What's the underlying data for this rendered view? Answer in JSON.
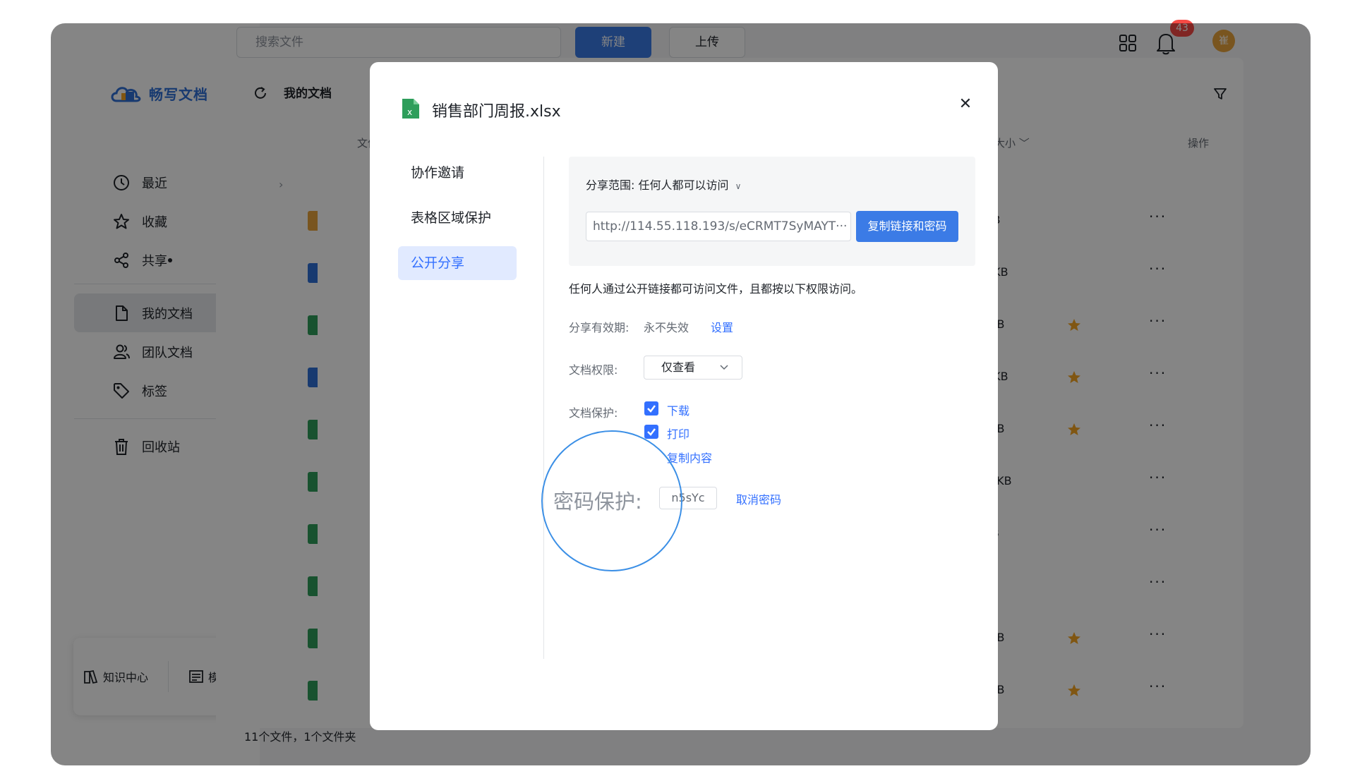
{
  "app": {
    "logo_text": "畅写文档"
  },
  "sidebar": {
    "items": [
      {
        "label": "最近"
      },
      {
        "label": "收藏"
      },
      {
        "label": "共享"
      },
      {
        "label": "我的文档"
      },
      {
        "label": "团队文档"
      },
      {
        "label": "标签"
      },
      {
        "label": "回收站"
      }
    ],
    "bottom": {
      "knowledge": "知识中心",
      "templates": "模板库"
    }
  },
  "topbar": {
    "search_placeholder": "搜索文件",
    "new_label": "新建",
    "upload_label": "上传",
    "notifications": "43",
    "avatar_text": "崔"
  },
  "content": {
    "breadcrumb": "我的文档",
    "columns": {
      "name": "文件名",
      "size": "大小",
      "actions": "操作"
    },
    "rows": [
      {
        "size": "8MB",
        "starred": false
      },
      {
        "size": "93.4KB",
        "starred": false
      },
      {
        "size": "7.5KB",
        "starred": true
      },
      {
        "size": "31.2KB",
        "starred": true
      },
      {
        "size": "6.4KB",
        "starred": true
      },
      {
        "size": "246.6KB",
        "starred": false
      },
      {
        "size": "9KB",
        "starred": false
      },
      {
        "size": "0B",
        "starred": false
      },
      {
        "size": "6.4KB",
        "starred": true
      },
      {
        "size": "6.4KB",
        "starred": true
      }
    ],
    "more": "···",
    "footer": "11个文件，1个文件夹"
  },
  "modal": {
    "title": "销售部门周报.xlsx",
    "nav": [
      {
        "label": "协作邀请"
      },
      {
        "label": "表格区域保护"
      },
      {
        "label": "公开分享"
      }
    ],
    "share_scope_label": "分享范围:",
    "share_scope_value": "任何人都可以访问",
    "link_value": "http://114.55.118.193/s/eCRMT7SyMAYT···",
    "copy_button": "复制链接和密码",
    "description": "任何人通过公开链接都可访问文件，且都按以下权限访问。",
    "validity_label": "分享有效期:",
    "validity_value": "永不失效",
    "validity_set": "设置",
    "permission_label": "文档权限:",
    "permission_value": "仅查看",
    "protection_label": "文档保护:",
    "protection_options": [
      {
        "label": "下载",
        "checked": true
      },
      {
        "label": "打印",
        "checked": true
      },
      {
        "label": "复制内容",
        "checked": false
      }
    ],
    "password_label": "密码保护:",
    "password_value": "n5sYc",
    "cancel_password": "取消密码"
  },
  "colors": {
    "accent": "#3b7be6",
    "link": "#3370ff",
    "star": "#f5a623"
  }
}
